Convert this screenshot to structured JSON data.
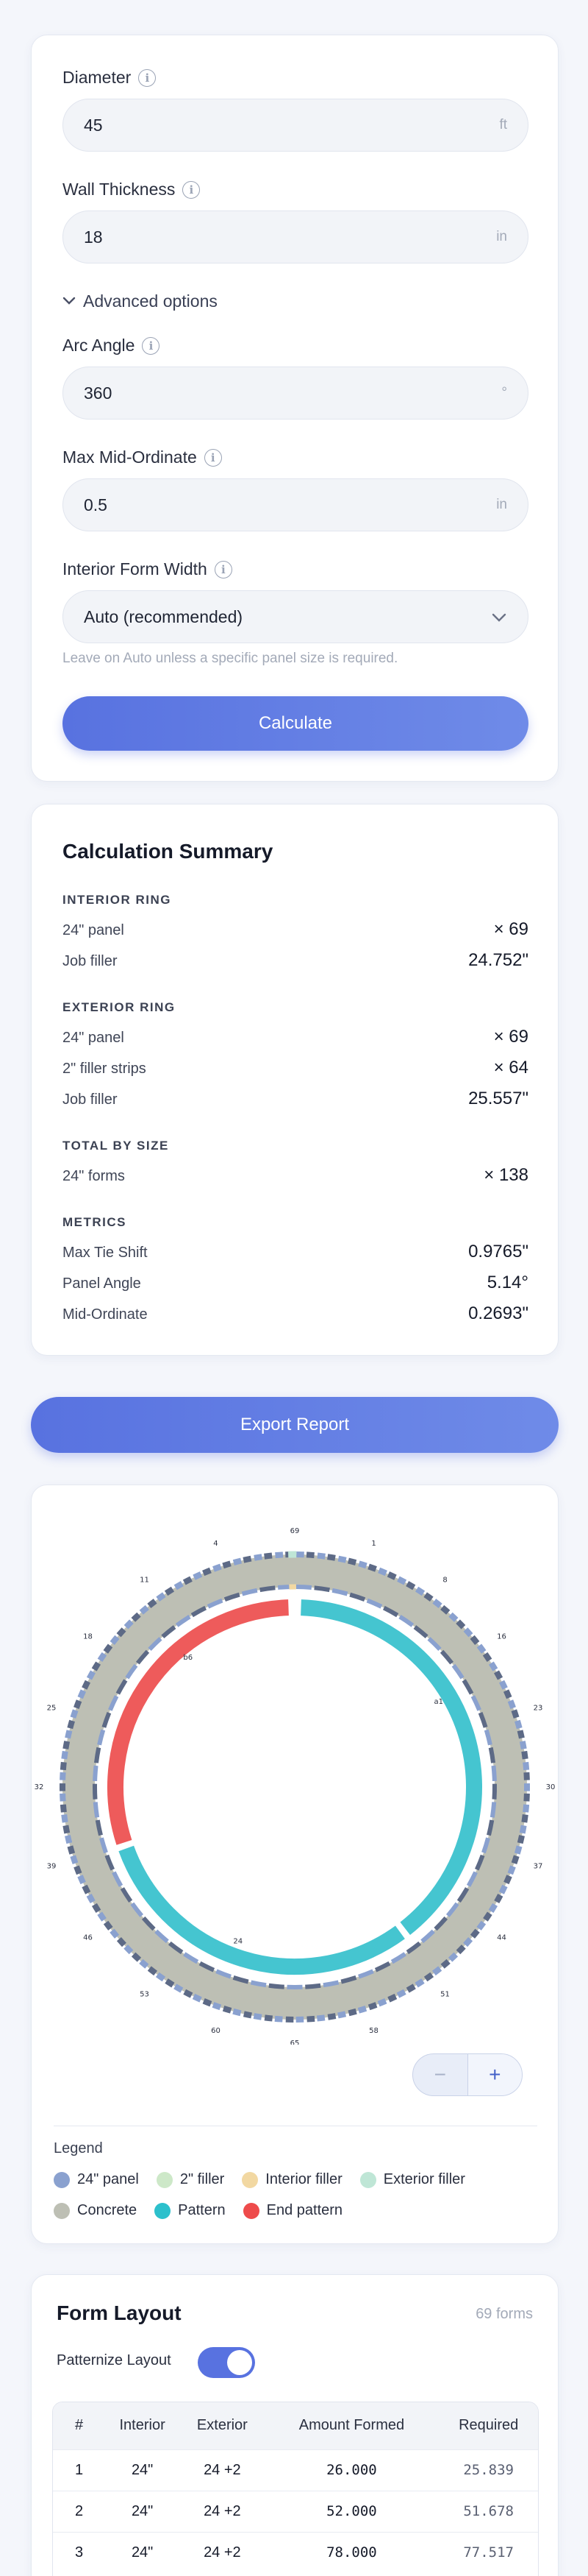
{
  "inputs": {
    "diameter": {
      "label": "Diameter",
      "value": "45",
      "unit": "ft"
    },
    "wall_thickness": {
      "label": "Wall Thickness",
      "value": "18",
      "unit": "in"
    },
    "advanced_label": "Advanced options",
    "arc_angle": {
      "label": "Arc Angle",
      "value": "360",
      "unit": "°"
    },
    "max_mid_ordinate": {
      "label": "Max Mid-Ordinate",
      "value": "0.5",
      "unit": "in"
    },
    "interior_form_width": {
      "label": "Interior Form Width",
      "selected": "Auto (recommended)"
    },
    "hint": "Leave on Auto unless a specific panel size is required.",
    "calculate_label": "Calculate"
  },
  "summary": {
    "title": "Calculation Summary",
    "interior_ring": {
      "heading": "INTERIOR RING",
      "rows": [
        {
          "label": "24\" panel",
          "value": "× 69"
        },
        {
          "label": "Job filler",
          "value": "24.752\""
        }
      ]
    },
    "exterior_ring": {
      "heading": "EXTERIOR RING",
      "rows": [
        {
          "label": "24\" panel",
          "value": "× 69"
        },
        {
          "label": "2\" filler strips",
          "value": "× 64"
        },
        {
          "label": "Job filler",
          "value": "25.557\""
        }
      ]
    },
    "total_by_size": {
      "heading": "TOTAL BY SIZE",
      "rows": [
        {
          "label": "24\" forms",
          "value": "× 138"
        }
      ]
    },
    "metrics": {
      "heading": "METRICS",
      "rows": [
        {
          "label": "Max Tie Shift",
          "value": "0.9765\""
        },
        {
          "label": "Panel Angle",
          "value": "5.14°"
        },
        {
          "label": "Mid-Ordinate",
          "value": "0.2693\""
        }
      ]
    }
  },
  "export_label": "Export Report",
  "diagram": {
    "ring_labels": [
      "69",
      "1",
      "8",
      "16",
      "23",
      "30",
      "37",
      "44",
      "51",
      "58",
      "65",
      "60",
      "53",
      "46",
      "39",
      "32",
      "25",
      "18",
      "11",
      "4"
    ],
    "pattern_labels": [
      "a1",
      "24",
      "b6"
    ],
    "zoom_out": "−",
    "zoom_in": "+",
    "colors": {
      "panel": "#8aa1cf",
      "panel_dark": "#5d6a86",
      "filler_2in": "#cde8c8",
      "interior_filler": "#f2d8a2",
      "exterior_filler": "#bfe6d6",
      "concrete": "#bdbfb4",
      "pattern": "#45c5d0",
      "end_pattern": "#ee5b5b"
    }
  },
  "legend": {
    "title": "Legend",
    "items": [
      {
        "label": "24\" panel",
        "color": "#8aa1cf"
      },
      {
        "label": "2\" filler",
        "color": "#cde8c8"
      },
      {
        "label": "Interior filler",
        "color": "#f2d8a2"
      },
      {
        "label": "Exterior filler",
        "color": "#bfe6d6"
      },
      {
        "label": "Concrete",
        "color": "#bdbfb4"
      },
      {
        "label": "Pattern",
        "color": "#2cc0cc"
      },
      {
        "label": "End pattern",
        "color": "#ee4b4b"
      }
    ]
  },
  "form_layout": {
    "title": "Form Layout",
    "count": "69 forms",
    "toggle_label": "Patternize Layout",
    "toggle_on": true,
    "columns": [
      "#",
      "Interior",
      "Exterior",
      "Amount Formed",
      "Required"
    ],
    "rows": [
      [
        "1",
        "24\"",
        "24 +2",
        "26.000",
        "25.839"
      ],
      [
        "2",
        "24\"",
        "24 +2",
        "52.000",
        "51.678"
      ],
      [
        "3",
        "24\"",
        "24 +2",
        "78.000",
        "77.517"
      ]
    ]
  }
}
